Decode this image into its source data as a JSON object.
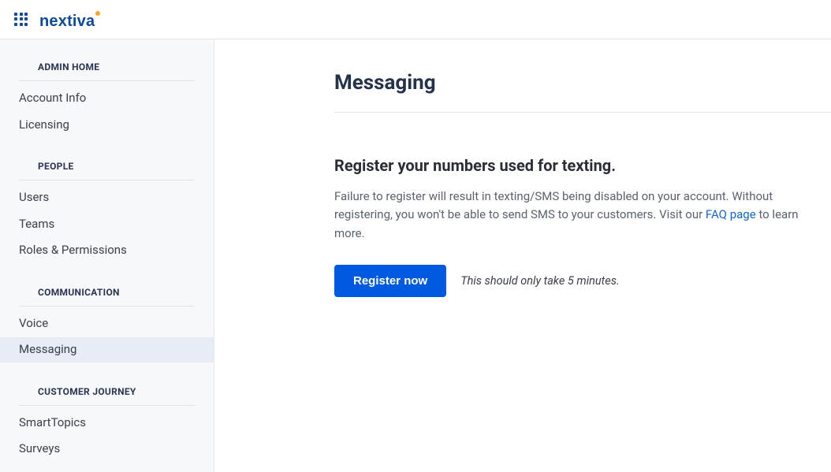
{
  "header": {
    "brand": "nextiva"
  },
  "sidebar": {
    "sections": [
      {
        "header": "ADMIN HOME",
        "items": [
          {
            "label": "Account Info",
            "slug": "account-info",
            "active": false
          },
          {
            "label": "Licensing",
            "slug": "licensing",
            "active": false
          }
        ]
      },
      {
        "header": "PEOPLE",
        "items": [
          {
            "label": "Users",
            "slug": "users",
            "active": false
          },
          {
            "label": "Teams",
            "slug": "teams",
            "active": false
          },
          {
            "label": "Roles & Permissions",
            "slug": "roles-permissions",
            "active": false
          }
        ]
      },
      {
        "header": "COMMUNICATION",
        "items": [
          {
            "label": "Voice",
            "slug": "voice",
            "active": false
          },
          {
            "label": "Messaging",
            "slug": "messaging",
            "active": true
          }
        ]
      },
      {
        "header": "CUSTOMER JOURNEY",
        "items": [
          {
            "label": "SmartTopics",
            "slug": "smarttopics",
            "active": false
          },
          {
            "label": "Surveys",
            "slug": "surveys",
            "active": false
          }
        ]
      }
    ]
  },
  "main": {
    "title": "Messaging",
    "section_title": "Register your numbers used for texting.",
    "desc_prefix": "Failure to register will result in texting/SMS being disabled on your account. Without registering, you won't be able to send SMS to your customers. Visit our ",
    "desc_link": "FAQ page",
    "desc_suffix": " to learn more.",
    "button_label": "Register now",
    "hint": "This should only take 5 minutes."
  },
  "colors": {
    "brand_primary": "#005ae0",
    "brand_accent": "#f5a623",
    "sidebar_bg": "#f6f8fa",
    "link": "#1565c0"
  }
}
